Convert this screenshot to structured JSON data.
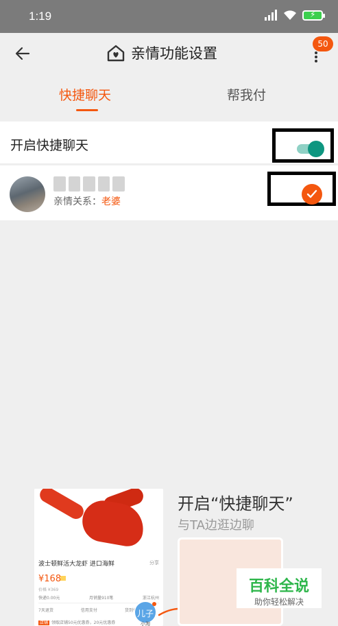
{
  "status_bar": {
    "time": "1:19"
  },
  "nav": {
    "title": "亲情功能设置",
    "badge": "50"
  },
  "tabs": [
    {
      "label": "快捷聊天"
    },
    {
      "label": "帮我付"
    }
  ],
  "quick_chat": {
    "toggle_label": "开启快捷聊天",
    "toggle_on": true,
    "relation_prefix": "亲情关系：",
    "relation_value": "老婆",
    "selected": true
  },
  "promo": {
    "headline": "开启“快捷聊天”",
    "subline": "与TA边逛边聊",
    "product": {
      "title": "波士顿鲜活大龙虾 进口海鲜",
      "share": "分享",
      "price": "¥168",
      "orig_price": "价格 ¥369",
      "shipping": "快递0.00元",
      "monthly_sales": "月销量910笔",
      "location": "浙江杭州",
      "services": [
        "7天退货",
        "信用支付",
        "货到付款"
      ],
      "coupon_tag": "店铺",
      "coupon_text": "领取店铺50元优惠券，20元优惠券"
    },
    "son_label": "儿子",
    "son_sub": "小淘"
  },
  "watermark": {
    "main": "百科全说",
    "sub": "助你轻松解决"
  },
  "colors": {
    "accent": "#f4570f",
    "toggle": "#0e9680",
    "watermark": "#2eb64b"
  }
}
